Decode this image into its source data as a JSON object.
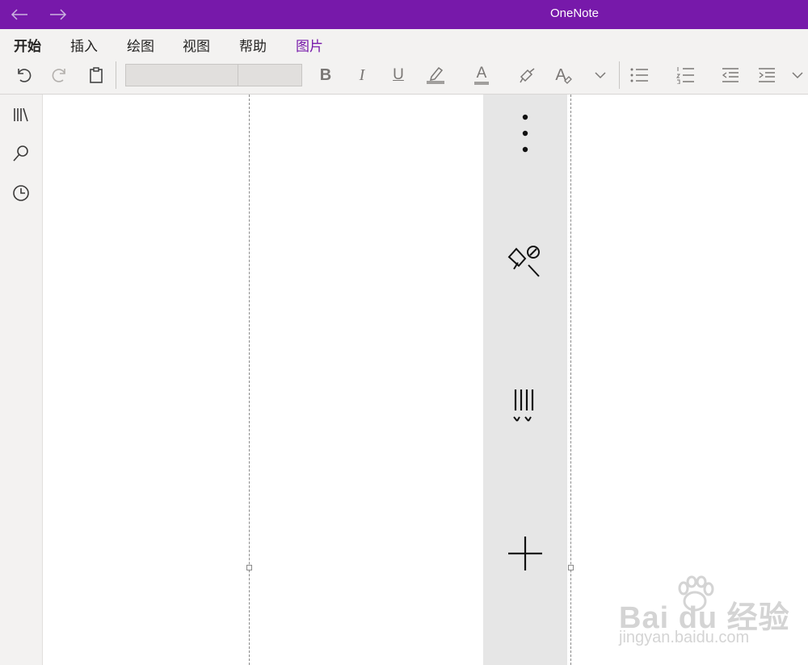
{
  "window": {
    "title": "OneNote",
    "accent": "#7719aa"
  },
  "ribbon_tabs": [
    {
      "label": "开始",
      "active": true
    },
    {
      "label": "插入",
      "active": false
    },
    {
      "label": "绘图",
      "active": false
    },
    {
      "label": "视图",
      "active": false
    },
    {
      "label": "帮助",
      "active": false
    },
    {
      "label": "图片",
      "active": false,
      "contextual": true
    }
  ],
  "toolbar": {
    "font_name": "",
    "font_size": "",
    "bold_glyph": "B",
    "italic_glyph": "I",
    "underline_glyph": "U",
    "font_color_glyph": "A",
    "clear_format_glyph": "A"
  },
  "sidebar": {
    "items": [
      {
        "icon": "notebooks-icon"
      },
      {
        "icon": "search-icon"
      },
      {
        "icon": "recent-clock-icon"
      }
    ]
  },
  "image_toolbar": {
    "items": [
      {
        "icon": "more-options-icon"
      },
      {
        "icon": "unpin-icon"
      },
      {
        "icon": "pattern-lines-icon"
      },
      {
        "icon": "add-plus-icon"
      }
    ]
  },
  "watermark": {
    "brand": "Bai du 经验",
    "url": "jingyan.baidu.com"
  }
}
